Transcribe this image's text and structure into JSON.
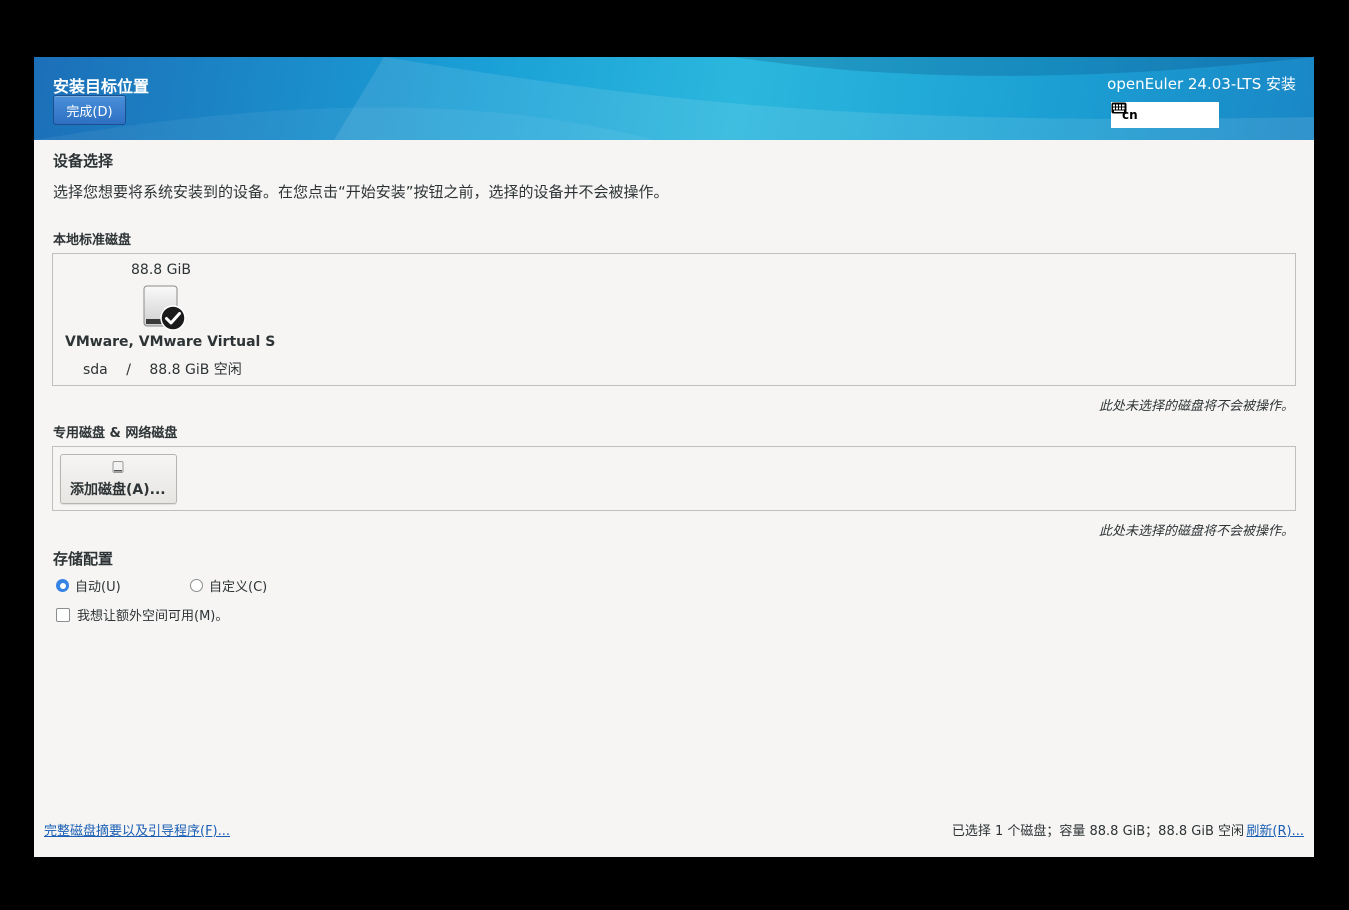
{
  "header": {
    "spoke_title": "安装目标位置",
    "done_label": "完成(D)",
    "product_title": "openEuler 24.03-LTS 安装",
    "keyboard_layout": "cn"
  },
  "device_selection": {
    "title": "设备选择",
    "description": "选择您想要将系统安装到的设备。在您点击“开始安装”按钮之前，选择的设备并不会被操作。"
  },
  "local_disks": {
    "title": "本地标准磁盘",
    "disks": [
      {
        "size": "88.8 GiB",
        "name": "VMware, VMware Virtual S",
        "device": "sda",
        "separator": "/",
        "free": "88.8 GiB 空闲",
        "selected": true
      }
    ],
    "note": "此处未选择的磁盘将不会被操作。"
  },
  "specialized_disks": {
    "title": "专用磁盘 & 网络磁盘",
    "add_disk_label": "添加磁盘(A)...",
    "note": "此处未选择的磁盘将不会被操作。"
  },
  "storage_config": {
    "title": "存储配置",
    "options": [
      {
        "label": "自动(U)",
        "selected": true
      },
      {
        "label": "自定义(C)",
        "selected": false
      }
    ],
    "extra_space_label": "我想让额外空间可用(M)。",
    "extra_space_checked": false
  },
  "footer": {
    "summary_link": "完整磁盘摘要以及引导程序(F)...",
    "status": "已选择 1 个磁盘；容量 88.8 GiB；88.8 GiB 空闲",
    "refresh_link": "刷新(R)..."
  },
  "colors": {
    "accent": "#3584e4",
    "link": "#1a5fb4",
    "header": "#1aa0d6"
  }
}
